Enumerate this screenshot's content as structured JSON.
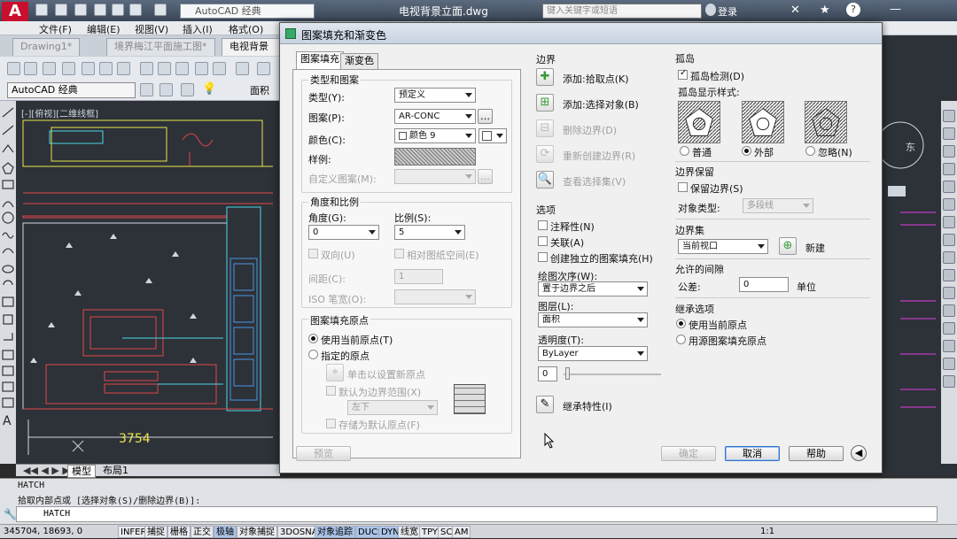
{
  "app": {
    "logo": "A",
    "workspace": "AutoCAD 经典",
    "title": "电视背景立面.dwg",
    "search_placeholder": "键入关键字或短语",
    "login": "登录"
  },
  "menu": [
    "文件(F)",
    "编辑(E)",
    "视图(V)",
    "插入(I)",
    "格式(O)"
  ],
  "doc_tabs": [
    "Drawing1*",
    "境界梅江平面施工图*",
    "电视背景立"
  ],
  "toolbar2": {
    "workspace": "AutoCAD 经典",
    "layer": "面积"
  },
  "drawing": {
    "viewport_label": "[-][俯视][二维线框]",
    "dimension": "3754",
    "model_tab": "模型",
    "layout_tab": "布局1"
  },
  "right_annotations": [
    "东"
  ],
  "command": {
    "line1": "HATCH",
    "line2": "拾取内部点或 [选择对象(S)/删除边界(B)]:",
    "input": "HATCH"
  },
  "status": {
    "coords": "345704, 18693, 0",
    "buttons": [
      "INFER",
      "捕捉",
      "栅格",
      "正交",
      "极轴",
      "对象捕捉",
      "3DOSNAP",
      "对象追踪",
      "DUCS",
      "DYN",
      "线宽",
      "TPY",
      "SC",
      "AM"
    ],
    "active": [
      "极轴",
      "对象追踪",
      "DUCS",
      "DYN"
    ],
    "scale": "1:1"
  },
  "dialog": {
    "title": "图案填充和渐变色",
    "tabs": [
      "图案填充",
      "渐变色"
    ],
    "type_pattern": {
      "heading": "类型和图案",
      "type_label": "类型(Y):",
      "type_value": "预定义",
      "pattern_label": "图案(P):",
      "pattern_value": "AR-CONC",
      "color_label": "颜色(C):",
      "color_value": "颜色 9",
      "swatch_label": "样例:",
      "custom_label": "自定义图案(M):"
    },
    "angle_scale": {
      "heading": "角度和比例",
      "angle_label": "角度(G):",
      "angle_value": "0",
      "scale_label": "比例(S):",
      "scale_value": "5",
      "double_label": "双向(U)",
      "relative_label": "相对图纸空间(E)",
      "spacing_label": "间距(C):",
      "spacing_value": "1",
      "iso_label": "ISO 笔宽(O):"
    },
    "origin": {
      "heading": "图案填充原点",
      "current_label": "使用当前原点(T)",
      "specified_label": "指定的原点",
      "click_set_label": "单击以设置新原点",
      "default_extents_label": "默认为边界范围(X)",
      "extents_value": "左下",
      "store_label": "存储为默认原点(F)"
    },
    "boundaries": {
      "heading": "边界",
      "add_pick": "添加:拾取点(K)",
      "add_select": "添加:选择对象(B)",
      "remove": "删除边界(D)",
      "recreate": "重新创建边界(R)",
      "view_selection": "查看选择集(V)"
    },
    "options": {
      "heading": "选项",
      "annotative": "注释性(N)",
      "associative": "关联(A)",
      "separate": "创建独立的图案填充(H)",
      "draw_order_label": "绘图次序(W):",
      "draw_order_value": "置于边界之后",
      "layer_label": "图层(L):",
      "layer_value": "面积",
      "transparency_label": "透明度(T):",
      "transparency_value": "ByLayer",
      "transparency_number": "0"
    },
    "inherit": "继承特性(I)",
    "islands": {
      "heading": "孤岛",
      "detect_label": "孤岛检测(D)",
      "style_label": "孤岛显示样式:",
      "styles": [
        "普通",
        "外部",
        "忽略(N)"
      ]
    },
    "boundary_retention": {
      "heading": "边界保留",
      "retain_label": "保留边界(S)",
      "object_type_label": "对象类型:",
      "object_type_value": "多段线"
    },
    "boundary_set": {
      "heading": "边界集",
      "value": "当前视口",
      "new_label": "新建"
    },
    "gap": {
      "heading": "允许的间隙",
      "tolerance_label": "公差:",
      "tolerance_value": "0",
      "unit_label": "单位"
    },
    "inherit_options": {
      "heading": "继承选项",
      "current_label": "使用当前原点",
      "source_label": "用源图案填充原点"
    },
    "buttons": {
      "preview": "预览",
      "ok": "确定",
      "cancel": "取消",
      "help": "帮助"
    }
  },
  "colors": {
    "accent": "#c8102e",
    "drawing_bg": "#2d3138",
    "dialog_bg": "#f0f0f0"
  }
}
